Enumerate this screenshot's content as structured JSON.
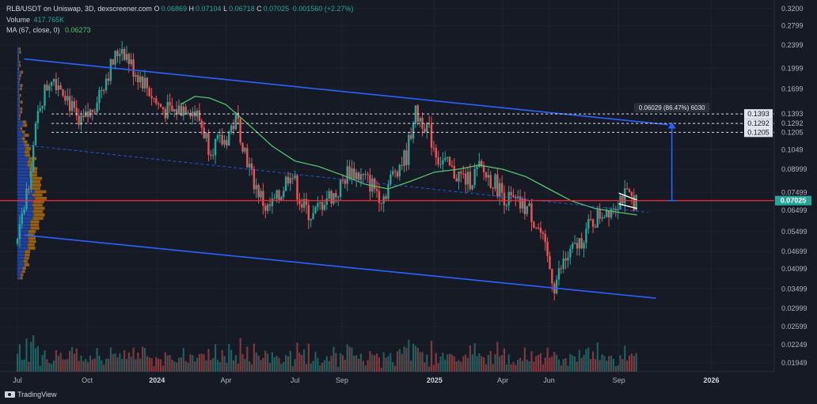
{
  "header": {
    "line1_title": "RLB/USDT on Uniswap, 3D, dexscreener.com",
    "ohlc": [
      {
        "k": "O",
        "v": "0.06869"
      },
      {
        "k": "H",
        "v": "0.07104"
      },
      {
        "k": "L",
        "v": "0.06718"
      },
      {
        "k": "C",
        "v": "0.07025"
      }
    ],
    "change": "0.001560 (+2.27%)",
    "volume_label": "Volume",
    "volume_value": "417.765K",
    "ma_label": "MA (67, close, 0)",
    "ma_value": "0.06273"
  },
  "branding": {
    "logo_text": "TradingView"
  },
  "colors": {
    "background": "#161a25",
    "up": "#26a69a",
    "down": "#ef5350",
    "ma_line": "#57c46b",
    "channel": "#2962ff",
    "level": "#ff2b2b",
    "measure": "#2962ff"
  },
  "chart_data": {
    "type": "candlestick",
    "pair": "RLB/USDT",
    "timeframe": "3D",
    "scale": "log",
    "ylim": [
      0.0182,
      0.33
    ],
    "price_axis_labels": [
      "0.3200",
      "0.2799",
      "0.2399",
      "0.1999",
      "0.1699",
      "0.1393",
      "0.1292",
      "0.1205",
      "0.1049",
      "0.08999",
      "0.07499",
      "0.07025",
      "0.06499",
      "0.05499",
      "0.04699",
      "0.04099",
      "0.03499",
      "0.02999",
      "0.02599",
      "0.02249",
      "0.01949"
    ],
    "price_axis_ticks": [
      0.32,
      0.2799,
      0.2399,
      0.1999,
      0.1699,
      0.1049,
      0.08999,
      0.07499,
      0.06499,
      0.05499,
      0.04699,
      0.04099,
      0.03499,
      0.02999,
      0.02599,
      0.02249,
      0.01949
    ],
    "time_labels": [
      "Jul",
      "Oct",
      "2024",
      "Apr",
      "Jul",
      "Sep",
      "2025",
      "Apr",
      "Jun",
      "Sep",
      "2026"
    ],
    "time_ticks": [
      "2023-07-01",
      "2023-10-01",
      "2024-01-01",
      "2024-04-01",
      "2024-07-01",
      "2024-09-01",
      "2025-01-01",
      "2025-04-01",
      "2025-06-01",
      "2025-09-01",
      "2026-01-01"
    ],
    "x_range": [
      "2023-06-08",
      "2026-03-25"
    ],
    "last_price": {
      "value": 0.07025,
      "label": "0.07025"
    },
    "horizontal_level": 0.07025,
    "target_levels": [
      {
        "value": 0.1393,
        "label": "0.1393"
      },
      {
        "value": 0.1292,
        "label": "0.1292"
      },
      {
        "value": 0.1205,
        "label": "0.1205"
      }
    ],
    "measurement": {
      "label": "0.06029 (86.47%) 6030",
      "from": 0.07025,
      "to": 0.1305,
      "date": "2025-11-10"
    },
    "channel_upper": [
      {
        "date": "2023-07-10",
        "price": 0.215
      },
      {
        "date": "2025-11-05",
        "price": 0.128
      }
    ],
    "channel_lower": [
      {
        "date": "2023-07-10",
        "price": 0.0535
      },
      {
        "date": "2025-10-20",
        "price": 0.0325
      }
    ],
    "channel_mid": [
      {
        "date": "2023-07-10",
        "price": 0.109
      },
      {
        "date": "2025-10-10",
        "price": 0.064
      }
    ],
    "flag_upper": [
      {
        "date": "2025-09-01",
        "price": 0.0745
      },
      {
        "date": "2025-09-25",
        "price": 0.0705
      }
    ],
    "flag_lower": [
      {
        "date": "2025-09-01",
        "price": 0.0685
      },
      {
        "date": "2025-09-25",
        "price": 0.066
      }
    ],
    "price_path": [
      {
        "date": "2023-07-01",
        "price": 0.05
      },
      {
        "date": "2023-07-15",
        "price": 0.08
      },
      {
        "date": "2023-07-30",
        "price": 0.15
      },
      {
        "date": "2023-08-15",
        "price": 0.19
      },
      {
        "date": "2023-09-01",
        "price": 0.17
      },
      {
        "date": "2023-09-20",
        "price": 0.125
      },
      {
        "date": "2023-10-05",
        "price": 0.14
      },
      {
        "date": "2023-10-25",
        "price": 0.185
      },
      {
        "date": "2023-11-15",
        "price": 0.24
      },
      {
        "date": "2023-11-30",
        "price": 0.2
      },
      {
        "date": "2023-12-15",
        "price": 0.18
      },
      {
        "date": "2024-01-01",
        "price": 0.15
      },
      {
        "date": "2024-01-20",
        "price": 0.14
      },
      {
        "date": "2024-02-10",
        "price": 0.15
      },
      {
        "date": "2024-02-25",
        "price": 0.135
      },
      {
        "date": "2024-03-10",
        "price": 0.108
      },
      {
        "date": "2024-03-30",
        "price": 0.112
      },
      {
        "date": "2024-04-15",
        "price": 0.135
      },
      {
        "date": "2024-05-05",
        "price": 0.085
      },
      {
        "date": "2024-05-25",
        "price": 0.065
      },
      {
        "date": "2024-06-10",
        "price": 0.072
      },
      {
        "date": "2024-06-25",
        "price": 0.09
      },
      {
        "date": "2024-07-10",
        "price": 0.068
      },
      {
        "date": "2024-07-25",
        "price": 0.062
      },
      {
        "date": "2024-08-10",
        "price": 0.072
      },
      {
        "date": "2024-08-25",
        "price": 0.074
      },
      {
        "date": "2024-09-10",
        "price": 0.09
      },
      {
        "date": "2024-09-25",
        "price": 0.085
      },
      {
        "date": "2024-10-10",
        "price": 0.08
      },
      {
        "date": "2024-10-25",
        "price": 0.072
      },
      {
        "date": "2024-11-10",
        "price": 0.09
      },
      {
        "date": "2024-11-25",
        "price": 0.1
      },
      {
        "date": "2024-12-05",
        "price": 0.14
      },
      {
        "date": "2024-12-20",
        "price": 0.13
      },
      {
        "date": "2025-01-05",
        "price": 0.1
      },
      {
        "date": "2025-01-25",
        "price": 0.088
      },
      {
        "date": "2025-02-15",
        "price": 0.082
      },
      {
        "date": "2025-03-01",
        "price": 0.09
      },
      {
        "date": "2025-03-20",
        "price": 0.082
      },
      {
        "date": "2025-04-05",
        "price": 0.072
      },
      {
        "date": "2025-04-20",
        "price": 0.068
      },
      {
        "date": "2025-05-05",
        "price": 0.066
      },
      {
        "date": "2025-05-20",
        "price": 0.055
      },
      {
        "date": "2025-06-01",
        "price": 0.042
      },
      {
        "date": "2025-06-08",
        "price": 0.036
      },
      {
        "date": "2025-06-20",
        "price": 0.043
      },
      {
        "date": "2025-07-10",
        "price": 0.05
      },
      {
        "date": "2025-07-25",
        "price": 0.058
      },
      {
        "date": "2025-08-10",
        "price": 0.064
      },
      {
        "date": "2025-08-25",
        "price": 0.068
      },
      {
        "date": "2025-09-05",
        "price": 0.073
      },
      {
        "date": "2025-09-15",
        "price": 0.0715
      },
      {
        "date": "2025-09-25",
        "price": 0.07025
      }
    ],
    "ma_path": [
      {
        "date": "2024-02-01",
        "price": 0.15
      },
      {
        "date": "2024-02-20",
        "price": 0.16
      },
      {
        "date": "2024-03-10",
        "price": 0.158
      },
      {
        "date": "2024-04-01",
        "price": 0.15
      },
      {
        "date": "2024-05-01",
        "price": 0.128
      },
      {
        "date": "2024-06-01",
        "price": 0.108
      },
      {
        "date": "2024-07-01",
        "price": 0.096
      },
      {
        "date": "2024-08-01",
        "price": 0.092
      },
      {
        "date": "2024-09-01",
        "price": 0.086
      },
      {
        "date": "2024-10-01",
        "price": 0.08
      },
      {
        "date": "2024-11-01",
        "price": 0.077
      },
      {
        "date": "2024-12-01",
        "price": 0.082
      },
      {
        "date": "2025-01-01",
        "price": 0.088
      },
      {
        "date": "2025-02-01",
        "price": 0.09
      },
      {
        "date": "2025-03-01",
        "price": 0.093
      },
      {
        "date": "2025-04-01",
        "price": 0.09
      },
      {
        "date": "2025-05-01",
        "price": 0.085
      },
      {
        "date": "2025-06-01",
        "price": 0.077
      },
      {
        "date": "2025-07-01",
        "price": 0.07
      },
      {
        "date": "2025-08-01",
        "price": 0.066
      },
      {
        "date": "2025-09-01",
        "price": 0.064
      },
      {
        "date": "2025-09-25",
        "price": 0.06273
      }
    ]
  }
}
